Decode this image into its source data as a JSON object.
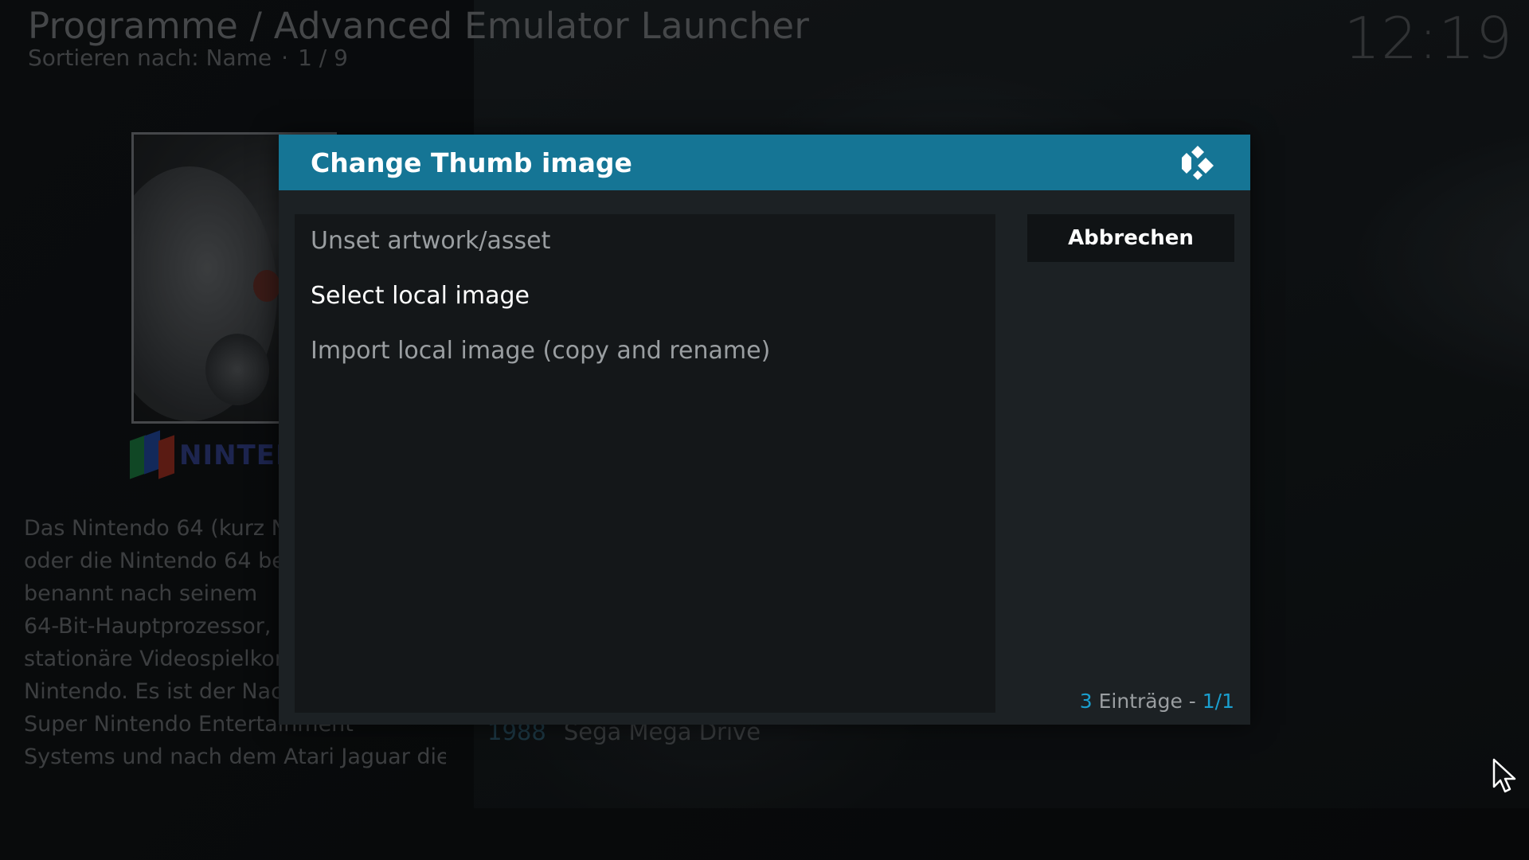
{
  "header": {
    "title": "Programme / Advanced Emulator Launcher",
    "sort_label": "Sortieren nach: Name",
    "separator": "·",
    "position": "1 / 9"
  },
  "clock": "12:19",
  "background": {
    "logo_text": "NINTENDO",
    "plot_lines": [
      "Das Nintendo 64 (kurz N",
      "oder die Nintendo 64 be",
      "benannt nach seinem",
      "64-Bit-Hauptprozessor, i",
      "stationäre Videospielkor",
      "Nintendo. Es ist der Nac",
      "Super Nintendo Entertainment",
      "Systems und nach dem Atari Jaguar die"
    ],
    "list_item": {
      "year": "1988",
      "name": "Sega Mega Drive"
    }
  },
  "dialog": {
    "title": "Change Thumb image",
    "items": [
      {
        "label": "Unset artwork/asset",
        "selected": false
      },
      {
        "label": "Select local image",
        "selected": true
      },
      {
        "label": "Import local image (copy and rename)",
        "selected": false
      }
    ],
    "cancel_label": "Abbrechen",
    "footer": {
      "count": "3",
      "count_text": " Einträge - ",
      "page": "1/1"
    }
  },
  "colors": {
    "accent": "#157595",
    "highlight": "#1a9fcf",
    "dialog_bg": "#1c2124",
    "list_bg": "#141719"
  },
  "icons": {
    "dialog_logo": "kodi-icon",
    "pointer": "mouse-cursor-icon"
  }
}
